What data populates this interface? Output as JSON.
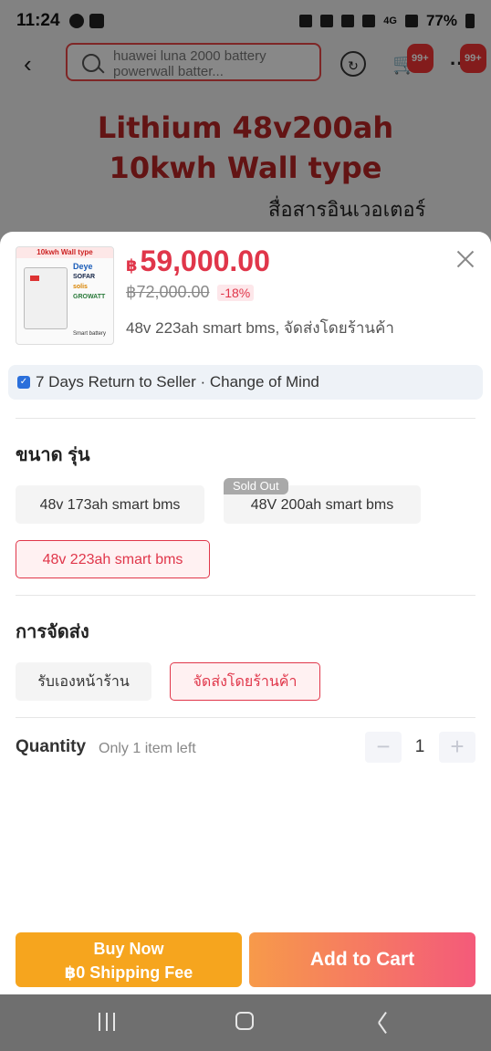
{
  "status_bar": {
    "time": "11:24",
    "network": "4G",
    "battery": "77%"
  },
  "top_nav": {
    "search_query": "huawei luna 2000 battery powerwall batter...",
    "cart_badge": "99+",
    "more_badge": "99+"
  },
  "hero": {
    "title_line1": "Lithium 48v200ah",
    "title_line2": "10kwh Wall type",
    "subtitle": "สื่อสารอินเวอเตอร์"
  },
  "product": {
    "thumb_caption": "10kwh Wall type",
    "thumb_brands": [
      "Deye",
      "SOFAR",
      "solis",
      "GROWATT"
    ],
    "thumb_footer": "Smart battery",
    "currency": "฿",
    "price": "59,000.00",
    "old_price": "฿72,000.00",
    "discount": "-18%",
    "selected_variant": "48v 223ah smart bms, จัดส่งโดยร้านค้า"
  },
  "return_policy": {
    "text": "7 Days Return to Seller · Change of Mind"
  },
  "size_section": {
    "title": "ขนาด รุ่น",
    "options": [
      {
        "label": "48v 173ah smart bms",
        "selected": false
      },
      {
        "label": "48V 200ah smart bms",
        "selected": false,
        "badge": "Sold Out"
      },
      {
        "label": "48v 223ah smart bms",
        "selected": true
      }
    ]
  },
  "shipping_section": {
    "title": "การจัดส่ง",
    "options": [
      {
        "label": "รับเองหน้าร้าน",
        "selected": false
      },
      {
        "label": "จัดส่งโดยร้านค้า",
        "selected": true
      }
    ]
  },
  "quantity": {
    "label": "Quantity",
    "note": "Only 1 item left",
    "value": "1",
    "minus": "−",
    "plus": "+"
  },
  "actions": {
    "buy_now_line1": "Buy Now",
    "buy_now_line2": "฿0 Shipping Fee",
    "add_to_cart": "Add to Cart"
  },
  "colors": {
    "accent": "#e0364a",
    "buy_now": "#f6a51e",
    "cart_start": "#f79a4a",
    "cart_end": "#f45a7a"
  }
}
